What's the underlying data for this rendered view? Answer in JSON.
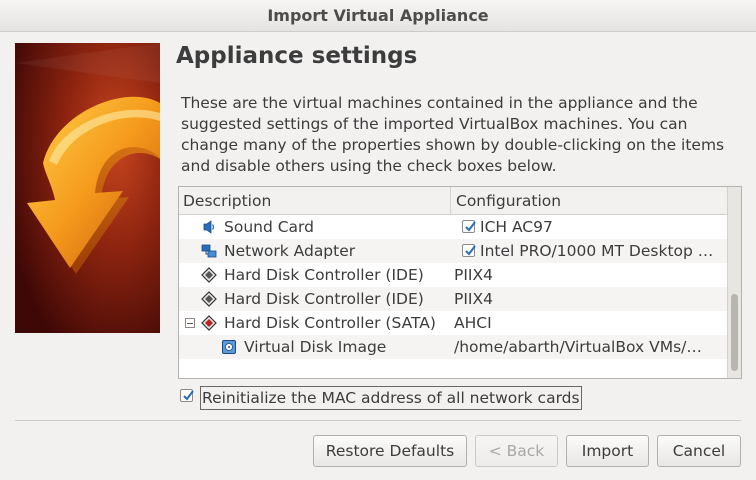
{
  "window": {
    "title": "Import Virtual Appliance"
  },
  "page": {
    "heading": "Appliance settings",
    "description": "These are the virtual machines contained in the appliance and the suggested settings of the imported VirtualBox machines. You can change many of the properties shown by double-clicking on the items and disable others using the check boxes below."
  },
  "tree": {
    "columns": [
      "Description",
      "Configuration"
    ],
    "rows": [
      {
        "label": "Sound Card",
        "value": "ICH AC97",
        "icon": "sound-card-icon",
        "checked": true
      },
      {
        "label": "Network Adapter",
        "value": "Intel PRO/1000 MT Desktop …",
        "icon": "network-adapter-icon",
        "checked": true
      },
      {
        "label": "Hard Disk Controller (IDE)",
        "value": "PIIX4",
        "icon": "ide-controller-icon"
      },
      {
        "label": "Hard Disk Controller (IDE)",
        "value": "PIIX4",
        "icon": "ide-controller-icon"
      },
      {
        "label": "Hard Disk Controller (SATA)",
        "value": "AHCI",
        "icon": "sata-controller-icon",
        "expanded": true
      },
      {
        "label": "Virtual Disk Image",
        "value": "/home/abarth/VirtualBox VMs/…",
        "icon": "disk-image-icon"
      }
    ]
  },
  "options": {
    "reinit_mac": {
      "label": "Reinitialize the MAC address of all network cards",
      "checked": true
    }
  },
  "buttons": {
    "restore": "Restore Defaults",
    "back": "< Back",
    "import": "Import",
    "cancel": "Cancel"
  },
  "colors": {
    "banner_dark": "#5a0f0a",
    "banner_orange": "#f0a020",
    "accent_blue": "#2a6cb8"
  }
}
